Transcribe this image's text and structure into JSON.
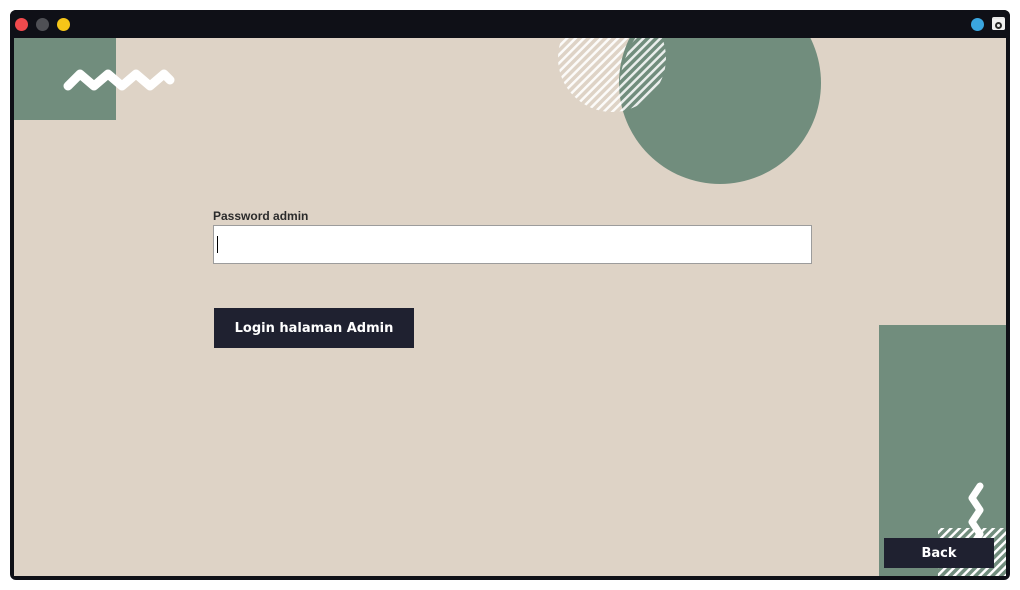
{
  "window": {
    "controls": {
      "close_color": "#f04a4d",
      "minimize_color": "#4f5055",
      "maximize_color": "#f5c518"
    },
    "tray_icons": [
      "globe-icon",
      "app-icon"
    ]
  },
  "form": {
    "password_label": "Password admin",
    "password_value": "",
    "login_label": "Login halaman Admin"
  },
  "footer": {
    "back_label": "Back"
  },
  "theme": {
    "background": "#ded3c6",
    "accent_green": "#718d7d",
    "button_dark": "#1f2130",
    "titlebar": "#0f1017"
  }
}
